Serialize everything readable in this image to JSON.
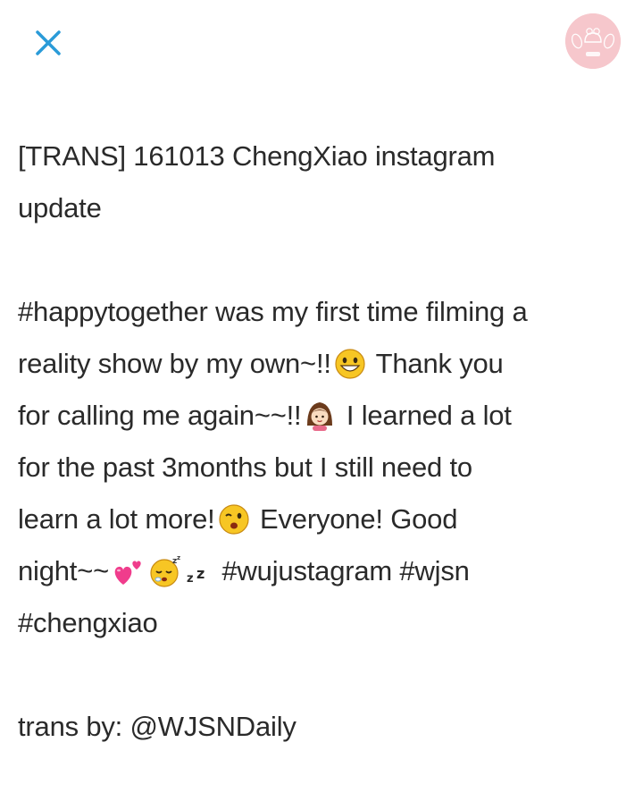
{
  "header": {
    "close_icon": "close-icon",
    "avatar_icon": "profile-avatar-icon"
  },
  "post": {
    "title_line1": "[TRANS] 161013 ChengXiao instagram",
    "title_line2": "update",
    "body": {
      "l1": "#happytogether was my first time filming a",
      "l2a": "reality show by my own~!!",
      "l2b": " Thank you",
      "l3a": "for calling me again~~!!",
      "l3b": " I learned a lot",
      "l4": "for the past 3months but I still need to",
      "l5a": "learn a lot more!",
      "l5b": " Everyone! Good",
      "l6a": "night~~",
      "l6b": " #wujustagram #wjsn",
      "l7": "#chengxiao"
    },
    "credit": "trans by: @WJSNDaily",
    "emojis": [
      "grinning-face-emoji",
      "girl-emoji",
      "winking-face-emoji",
      "two-hearts-emoji",
      "sleeping-face-emoji",
      "zzz-emoji"
    ]
  },
  "colors": {
    "accent": "#2a9bd8",
    "text": "#2a2a2a",
    "avatar_bg": "#f6c7cc"
  }
}
